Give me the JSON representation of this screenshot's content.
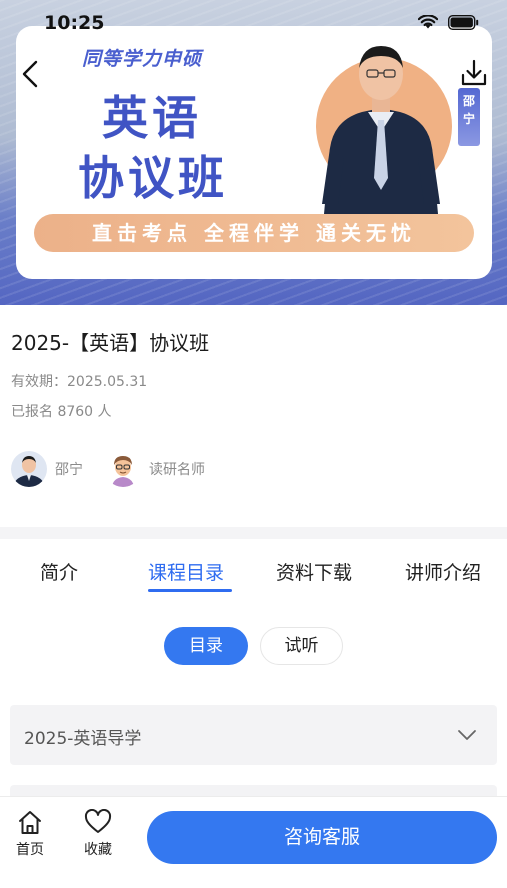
{
  "status_bar": {
    "time": "10:25"
  },
  "banner": {
    "subtitle": "同等学力申硕",
    "title_line1": "英语",
    "title_line2": "协议班",
    "slogan": "直击考点 全程伴学 通关无忧",
    "teacher_tag": "邵宁",
    "accent_color": "#4054c4"
  },
  "course": {
    "title": "2025-【英语】协议班",
    "validity": "有效期：2025.05.31",
    "enrolled": "已报名 8760 人",
    "teachers": [
      {
        "name": "邵宁",
        "avatar": "teacher-avatar"
      },
      {
        "name": "读研名师",
        "avatar": "cartoon-avatar"
      }
    ]
  },
  "tabs": [
    {
      "label": "简介",
      "active": false
    },
    {
      "label": "课程目录",
      "active": true
    },
    {
      "label": "资料下载",
      "active": false
    },
    {
      "label": "讲师介绍",
      "active": false
    }
  ],
  "segments": [
    {
      "label": "目录",
      "active": true
    },
    {
      "label": "试听",
      "active": false
    }
  ],
  "chapters": [
    {
      "title": "2025-英语导学",
      "icon": "chevron-down-icon"
    }
  ],
  "bottom_bar": {
    "home_label": "首页",
    "favorite_label": "收藏",
    "consult_label": "咨询客服",
    "primary_color": "#3478f0"
  }
}
